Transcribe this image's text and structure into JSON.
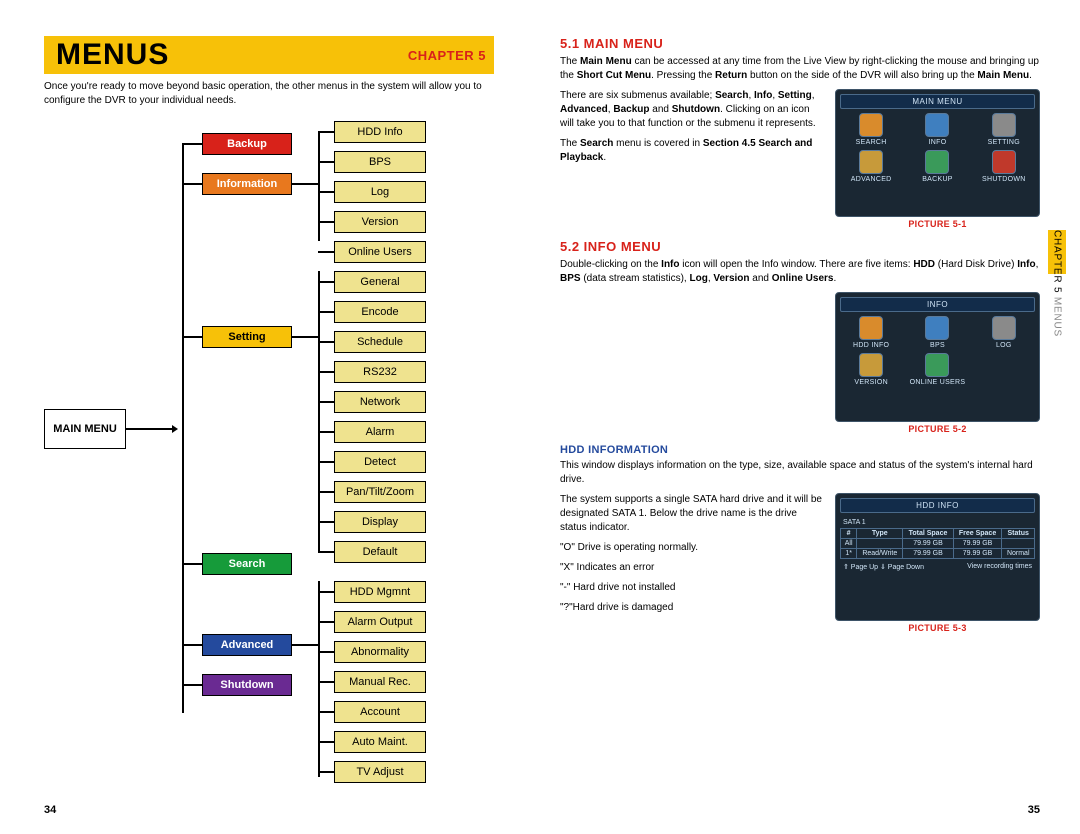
{
  "left": {
    "banner_title": "MENUS",
    "banner_chapter": "CHAPTER 5",
    "intro": "Once you're ready to move beyond basic operation, the other menus in the system will allow you to configure the DVR to your individual needs.",
    "root": "MAIN MENU",
    "cats": [
      {
        "label": "Backup",
        "class": "c-backup"
      },
      {
        "label": "Information",
        "class": "c-info"
      },
      {
        "label": "Setting",
        "class": "c-setting"
      },
      {
        "label": "Search",
        "class": "c-search"
      },
      {
        "label": "Advanced",
        "class": "c-advanced"
      },
      {
        "label": "Shutdown",
        "class": "c-shutdown"
      }
    ],
    "subs_info": [
      "HDD Info",
      "BPS",
      "Log",
      "Version",
      "Online Users"
    ],
    "subs_setting": [
      "General",
      "Encode",
      "Schedule",
      "RS232",
      "Network",
      "Alarm",
      "Detect",
      "Pan/Tilt/Zoom",
      "Display",
      "Default"
    ],
    "subs_adv": [
      "HDD Mgmnt",
      "Alarm Output",
      "Abnormality",
      "Manual Rec.",
      "Account",
      "Auto Maint.",
      "TV Adjust"
    ],
    "pagenum": "34"
  },
  "right": {
    "s1_heading": "5.1 MAIN MENU",
    "s1_p1_a": "The ",
    "s1_p1_b": "Main Menu",
    "s1_p1_c": " can be accessed at any time from the Live View by right-clicking the mouse and bringing up the ",
    "s1_p1_d": "Short Cut Menu",
    "s1_p1_e": ". Pressing the ",
    "s1_p1_f": "Return",
    "s1_p1_g": " button on the side of the DVR will also bring up the ",
    "s1_p1_h": "Main Menu",
    "s1_p1_i": ".",
    "s1_left_a": "There are six submenus available; ",
    "s1_left_b": "Search",
    "s1_left_c": ", ",
    "s1_left_d": "Info",
    "s1_left_e": ", ",
    "s1_left_f": "Setting",
    "s1_left_g": ", ",
    "s1_left_h": "Advanced",
    "s1_left_i": ", ",
    "s1_left_j": "Backup",
    "s1_left_k": " and ",
    "s1_left_l": "Shutdown",
    "s1_left_m": ". Clicking on an icon will take you to that function or the submenu it represents.",
    "s1_left2_a": "The ",
    "s1_left2_b": "Search",
    "s1_left2_c": " menu is covered in ",
    "s1_left2_d": "Section 4.5 Search and Playback",
    "s1_left2_e": ".",
    "pic1": {
      "title": "MAIN MENU",
      "items": [
        "SEARCH",
        "INFO",
        "SETTING",
        "ADVANCED",
        "BACKUP",
        "SHUTDOWN"
      ],
      "caption": "PICTURE 5-1"
    },
    "s2_heading": "5.2 INFO MENU",
    "s2_p_a": "Double-clicking on the ",
    "s2_p_b": "Info",
    "s2_p_c": " icon will open the Info window. There are five items: ",
    "s2_p_d": "HDD",
    "s2_p_e": " (Hard Disk Drive) ",
    "s2_p_f": "Info",
    "s2_p_g": ", ",
    "s2_p_h": "BPS",
    "s2_p_i": " (data stream statistics), ",
    "s2_p_j": "Log",
    "s2_p_k": ", ",
    "s2_p_l": "Version",
    "s2_p_m": " and ",
    "s2_p_n": "Online Users",
    "s2_p_o": ".",
    "pic2": {
      "title": "INFO",
      "items": [
        "HDD INFO",
        "BPS",
        "LOG",
        "VERSION",
        "ONLINE USERS"
      ],
      "caption": "PICTURE 5-2"
    },
    "hdd_heading": "HDD INFORMATION",
    "hdd_p1": "This window displays information on the type, size, available space and status of the system's internal hard drive.",
    "hdd_p2": "The system supports a single SATA hard drive and it will be designated SATA 1. Below the drive name is the drive status indicator.",
    "hdd_b1": "\"O\" Drive is operating normally.",
    "hdd_b2": "\"X\" Indicates an error",
    "hdd_b3": "\"-\" Hard drive not installed",
    "hdd_b4": "\"?\"Hard drive is damaged",
    "pic3": {
      "title": "HDD INFO",
      "sata": "SATA 1",
      "headers": [
        "#",
        "Type",
        "Total Space",
        "Free Space",
        "Status"
      ],
      "rows": [
        [
          "All",
          "",
          "79.99 GB",
          "79.99 GB",
          ""
        ],
        [
          "1*",
          "Read/Write",
          "79.99 GB",
          "79.99 GB",
          "Normal"
        ]
      ],
      "footer_l": "⇑ Page Up  ⇓ Page Down",
      "footer_r": "View recording times",
      "caption": "PICTURE 5-3"
    },
    "pagenum": "35"
  },
  "sidetab": {
    "a": "CHAPTER 5",
    "b": " MENUS"
  },
  "icon_colors": [
    "#d98b2c",
    "#3f7fbf",
    "#8a8a8a",
    "#c79a3a",
    "#3a9a5a",
    "#c0392b",
    "#3a6a9a",
    "#3a9a9a"
  ]
}
